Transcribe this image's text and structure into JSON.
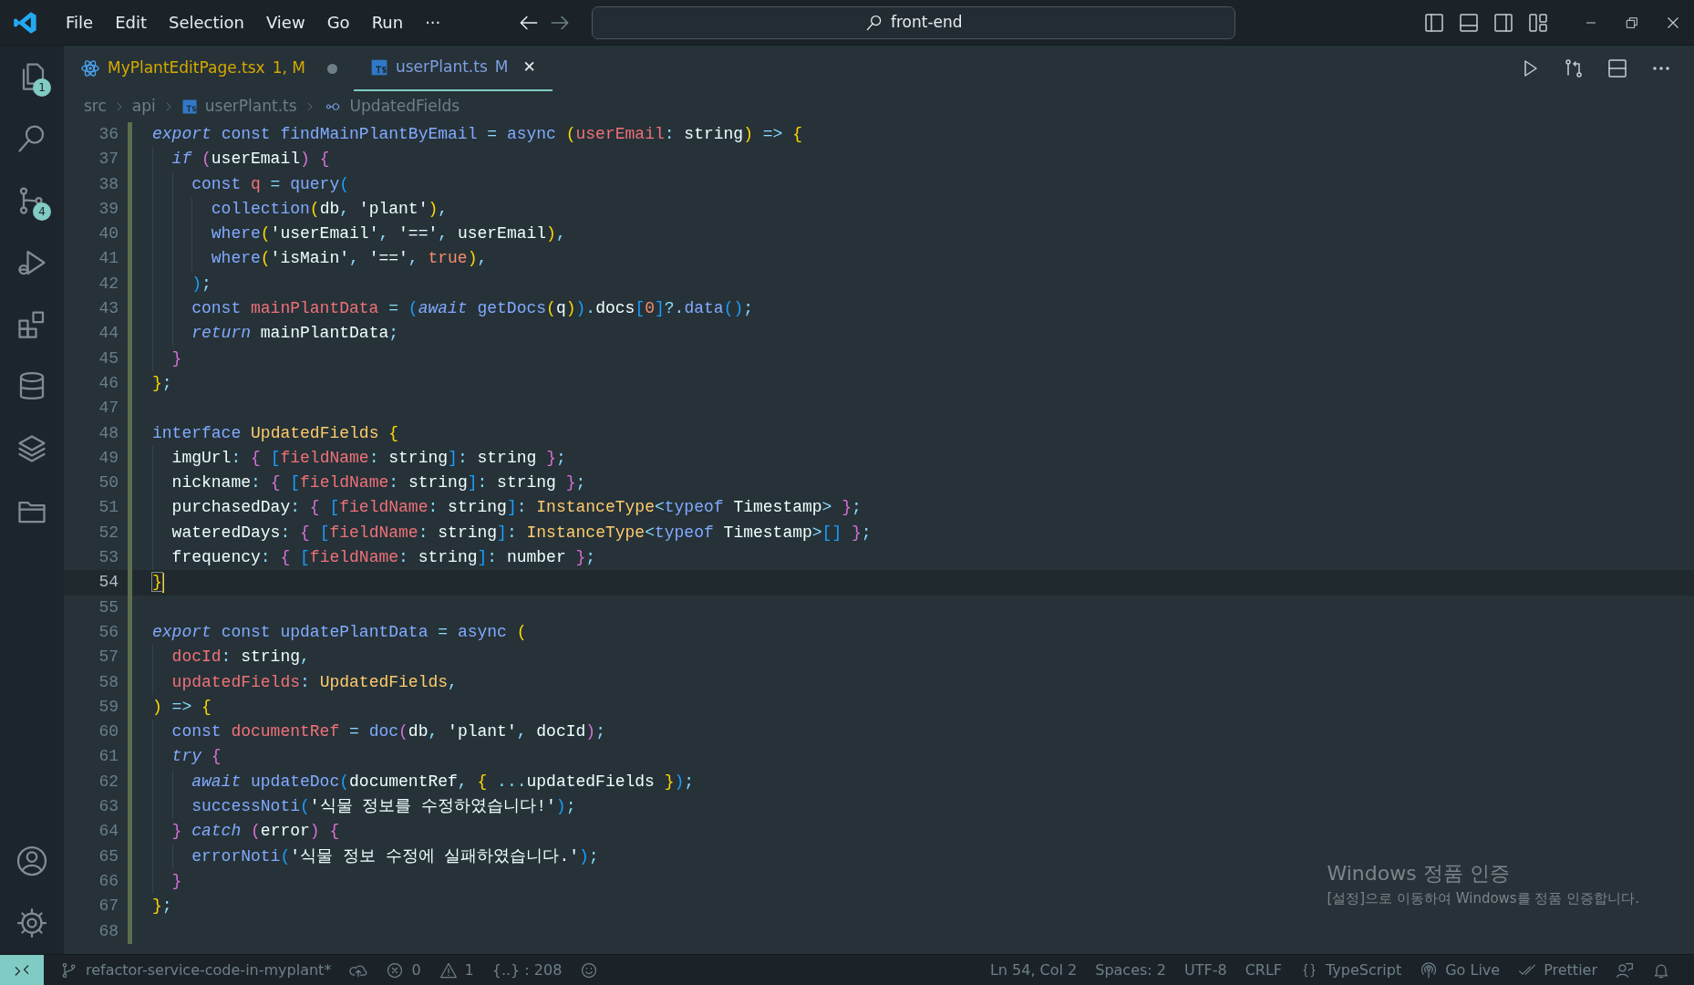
{
  "title_bar": {
    "menu": [
      "File",
      "Edit",
      "Selection",
      "View",
      "Go",
      "Run"
    ],
    "more": "···",
    "search": "front-end"
  },
  "activity_bar": {
    "items": [
      {
        "selected": false,
        "badge": "1"
      },
      {
        "selected": false
      },
      {
        "selected": false,
        "badge": "4"
      },
      {
        "selected": false
      },
      {
        "selected": false
      },
      {
        "selected": false
      },
      {
        "selected": false
      },
      {
        "selected": false
      }
    ],
    "bottom": [
      {
        "selected": false
      },
      {
        "selected": false
      }
    ]
  },
  "tabs": [
    {
      "label": "MyPlantEditPage.tsx",
      "status": "1, M",
      "kind": "react",
      "selected": false,
      "dirty": true
    },
    {
      "label": "userPlant.ts",
      "status": "M",
      "kind": "ts",
      "selected": true,
      "dirty": false,
      "close": "✕"
    }
  ],
  "breadcrumbs": [
    {
      "label": "src",
      "kind": "folder"
    },
    {
      "label": "api",
      "kind": "folder"
    },
    {
      "label": "userPlant.ts",
      "kind": "ts"
    },
    {
      "label": "UpdatedFields",
      "kind": "interface"
    }
  ],
  "editor": {
    "lines": [
      {
        "number": "36",
        "current": false,
        "modified": true,
        "tokens": [
          {
            "kw": "export "
          },
          {
            "st": "const "
          },
          {
            "fn": "findMainPlantByEmail"
          },
          {
            "op": " = "
          },
          {
            "st": "async "
          },
          {
            "b1": "("
          },
          {
            "var": "userEmail"
          },
          {
            "op": ": "
          },
          {
            "p": "string"
          },
          {
            "b1": ")"
          },
          {
            "op": " => "
          },
          {
            "b1": "{"
          }
        ]
      },
      {
        "number": "37",
        "current": false,
        "modified": true,
        "tokens": [
          {
            "kw": "  if "
          },
          {
            "b2": "("
          },
          {
            "p": "userEmail"
          },
          {
            "b2": ")"
          },
          {
            "b2": " {"
          }
        ]
      },
      {
        "number": "38",
        "current": false,
        "modified": true,
        "tokens": [
          {
            "st": "    const "
          },
          {
            "var": "q"
          },
          {
            "op": " = "
          },
          {
            "fn": "query"
          },
          {
            "b3": "("
          }
        ]
      },
      {
        "number": "39",
        "current": false,
        "modified": true,
        "tokens": [
          {
            "fn": "      collection"
          },
          {
            "b1": "("
          },
          {
            "p": "db"
          },
          {
            "op": ", "
          },
          {
            "str": "'plant'"
          },
          {
            "b1": ")"
          },
          {
            "op": ","
          }
        ]
      },
      {
        "number": "40",
        "current": false,
        "modified": true,
        "tokens": [
          {
            "fn": "      where"
          },
          {
            "b1": "("
          },
          {
            "str": "'userEmail'"
          },
          {
            "op": ", "
          },
          {
            "str": "'=='"
          },
          {
            "op": ", "
          },
          {
            "p": "userEmail"
          },
          {
            "b1": ")"
          },
          {
            "op": ","
          }
        ]
      },
      {
        "number": "41",
        "current": false,
        "modified": true,
        "tokens": [
          {
            "fn": "      where"
          },
          {
            "b1": "("
          },
          {
            "str": "'isMain'"
          },
          {
            "op": ", "
          },
          {
            "str": "'=='"
          },
          {
            "op": ", "
          },
          {
            "num": "true"
          },
          {
            "b1": ")"
          },
          {
            "op": ","
          }
        ]
      },
      {
        "number": "42",
        "current": false,
        "modified": true,
        "tokens": [
          {
            "b3": "    )"
          },
          {
            "op": ";"
          }
        ]
      },
      {
        "number": "43",
        "current": false,
        "modified": true,
        "tokens": [
          {
            "st": "    const "
          },
          {
            "var": "mainPlantData"
          },
          {
            "op": " = "
          },
          {
            "b3": "("
          },
          {
            "kw": "await "
          },
          {
            "fn": "getDocs"
          },
          {
            "b1": "("
          },
          {
            "p": "q"
          },
          {
            "b1": ")"
          },
          {
            "b3": ")"
          },
          {
            "op": "."
          },
          {
            "p": "docs"
          },
          {
            "b3": "["
          },
          {
            "num": "0"
          },
          {
            "b3": "]"
          },
          {
            "op": "?."
          },
          {
            "fn": "data"
          },
          {
            "b3": "()"
          },
          {
            "op": ";"
          }
        ]
      },
      {
        "number": "44",
        "current": false,
        "modified": true,
        "tokens": [
          {
            "kw": "    return "
          },
          {
            "p": "mainPlantData"
          },
          {
            "op": ";"
          }
        ]
      },
      {
        "number": "45",
        "current": false,
        "modified": true,
        "tokens": [
          {
            "b2": "  }"
          }
        ]
      },
      {
        "number": "46",
        "current": false,
        "modified": true,
        "tokens": [
          {
            "b1": "}"
          },
          {
            "op": ";"
          }
        ]
      },
      {
        "number": "47",
        "current": false,
        "modified": true
      },
      {
        "number": "48",
        "current": false,
        "modified": true,
        "tokens": [
          {
            "st": "interface "
          },
          {
            "ty": "UpdatedFields "
          },
          {
            "b1": "{"
          }
        ]
      },
      {
        "number": "49",
        "current": false,
        "modified": true,
        "tokens": [
          {
            "p": "  imgUrl"
          },
          {
            "op": ": "
          },
          {
            "b2": "{ "
          },
          {
            "b3": "["
          },
          {
            "var": "fieldName"
          },
          {
            "op": ": "
          },
          {
            "p": "string"
          },
          {
            "b3": "]"
          },
          {
            "op": ": "
          },
          {
            "p": "string "
          },
          {
            "b2": "}"
          },
          {
            "op": ";"
          }
        ]
      },
      {
        "number": "50",
        "current": false,
        "modified": true,
        "tokens": [
          {
            "p": "  nickname"
          },
          {
            "op": ": "
          },
          {
            "b2": "{ "
          },
          {
            "b3": "["
          },
          {
            "var": "fieldName"
          },
          {
            "op": ": "
          },
          {
            "p": "string"
          },
          {
            "b3": "]"
          },
          {
            "op": ": "
          },
          {
            "p": "string "
          },
          {
            "b2": "}"
          },
          {
            "op": ";"
          }
        ]
      },
      {
        "number": "51",
        "current": false,
        "modified": true,
        "tokens": [
          {
            "p": "  purchasedDay"
          },
          {
            "op": ": "
          },
          {
            "b2": "{ "
          },
          {
            "b3": "["
          },
          {
            "var": "fieldName"
          },
          {
            "op": ": "
          },
          {
            "p": "string"
          },
          {
            "b3": "]"
          },
          {
            "op": ": "
          },
          {
            "ty": "InstanceType"
          },
          {
            "op": "<"
          },
          {
            "st": "typeof "
          },
          {
            "p": "Timestamp"
          },
          {
            "op": "> "
          },
          {
            "b2": "}"
          },
          {
            "op": ";"
          }
        ]
      },
      {
        "number": "52",
        "current": false,
        "modified": true,
        "tokens": [
          {
            "p": "  wateredDays"
          },
          {
            "op": ": "
          },
          {
            "b2": "{ "
          },
          {
            "b3": "["
          },
          {
            "var": "fieldName"
          },
          {
            "op": ": "
          },
          {
            "p": "string"
          },
          {
            "b3": "]"
          },
          {
            "op": ": "
          },
          {
            "ty": "InstanceType"
          },
          {
            "op": "<"
          },
          {
            "st": "typeof "
          },
          {
            "p": "Timestamp"
          },
          {
            "op": ">"
          },
          {
            "b3": "[] "
          },
          {
            "b2": "}"
          },
          {
            "op": ";"
          }
        ]
      },
      {
        "number": "53",
        "current": false,
        "modified": true,
        "tokens": [
          {
            "p": "  frequency"
          },
          {
            "op": ": "
          },
          {
            "b2": "{ "
          },
          {
            "b3": "["
          },
          {
            "var": "fieldName"
          },
          {
            "op": ": "
          },
          {
            "p": "string"
          },
          {
            "b3": "]"
          },
          {
            "op": ": "
          },
          {
            "p": "number "
          },
          {
            "b2": "}"
          },
          {
            "op": ";"
          }
        ]
      },
      {
        "number": "54",
        "current": true,
        "modified": true,
        "tokens": [
          {
            "b1": "}"
          }
        ]
      },
      {
        "number": "55",
        "current": false,
        "modified": true
      },
      {
        "number": "56",
        "current": false,
        "modified": true,
        "tokens": [
          {
            "kw": "export "
          },
          {
            "st": "const "
          },
          {
            "fn": "updatePlantData"
          },
          {
            "op": " = "
          },
          {
            "st": "async "
          },
          {
            "b1": "("
          }
        ]
      },
      {
        "number": "57",
        "current": false,
        "modified": true,
        "tokens": [
          {
            "var": "  docId"
          },
          {
            "op": ": "
          },
          {
            "p": "string"
          },
          {
            "op": ","
          }
        ]
      },
      {
        "number": "58",
        "current": false,
        "modified": true,
        "tokens": [
          {
            "var": "  updatedFields"
          },
          {
            "op": ": "
          },
          {
            "ty": "UpdatedFields"
          },
          {
            "op": ","
          }
        ]
      },
      {
        "number": "59",
        "current": false,
        "modified": true,
        "tokens": [
          {
            "b1": ")"
          },
          {
            "op": " => "
          },
          {
            "b1": "{"
          }
        ]
      },
      {
        "number": "60",
        "current": false,
        "modified": true,
        "tokens": [
          {
            "st": "  const "
          },
          {
            "var": "documentRef"
          },
          {
            "op": " = "
          },
          {
            "fn": "doc"
          },
          {
            "b2": "("
          },
          {
            "p": "db"
          },
          {
            "op": ", "
          },
          {
            "str": "'plant'"
          },
          {
            "op": ", "
          },
          {
            "p": "docId"
          },
          {
            "b2": ")"
          },
          {
            "op": ";"
          }
        ]
      },
      {
        "number": "61",
        "current": false,
        "modified": true,
        "tokens": [
          {
            "kw": "  try "
          },
          {
            "b2": "{"
          }
        ]
      },
      {
        "number": "62",
        "current": false,
        "modified": true,
        "tokens": [
          {
            "kw": "    await "
          },
          {
            "fn": "updateDoc"
          },
          {
            "b3": "("
          },
          {
            "p": "documentRef"
          },
          {
            "op": ", "
          },
          {
            "b1": "{ "
          },
          {
            "op": "..."
          },
          {
            "p": "updatedFields "
          },
          {
            "b1": "}"
          },
          {
            "b3": ")"
          },
          {
            "op": ";"
          }
        ]
      },
      {
        "number": "63",
        "current": false,
        "modified": true,
        "tokens": [
          {
            "fn": "    successNoti"
          },
          {
            "b3": "("
          },
          {
            "str": "'식물 정보를 수정하였습니다!'"
          },
          {
            "b3": ")"
          },
          {
            "op": ";"
          }
        ]
      },
      {
        "number": "64",
        "current": false,
        "modified": true,
        "tokens": [
          {
            "b2": "  } "
          },
          {
            "kw": "catch "
          },
          {
            "b2": "("
          },
          {
            "p": "error"
          },
          {
            "b2": ") {"
          }
        ]
      },
      {
        "number": "65",
        "current": false,
        "modified": true,
        "tokens": [
          {
            "fn": "    errorNoti"
          },
          {
            "b3": "("
          },
          {
            "str": "'식물 정보 수정에 실패하였습니다.'"
          },
          {
            "b3": ")"
          },
          {
            "op": ";"
          }
        ]
      },
      {
        "number": "66",
        "current": false,
        "modified": true,
        "tokens": [
          {
            "b2": "  }"
          }
        ]
      },
      {
        "number": "67",
        "current": false,
        "modified": true,
        "tokens": [
          {
            "b1": "}"
          },
          {
            "op": ";"
          }
        ]
      },
      {
        "number": "68",
        "current": false,
        "modified": true
      }
    ]
  },
  "activation_notice": {
    "title": "Windows 정품 인증",
    "message": "[설정]으로 이동하여 Windows를 정품 인증합니다."
  },
  "status_bar": {
    "left": [
      {
        "kind": "branch",
        "text": "refactor-service-code-in-myplant*"
      },
      {
        "kind": "sync"
      },
      {
        "kind": "errors",
        "text": "0"
      },
      {
        "kind": "warnings",
        "text": "1"
      },
      {
        "kind": "plain",
        "text": "{..} : 208"
      },
      {
        "kind": "smiley"
      }
    ],
    "right": [
      {
        "kind": "plain",
        "text": "Ln 54, Col 2"
      },
      {
        "kind": "plain",
        "text": "Spaces: 2"
      },
      {
        "kind": "plain",
        "text": "UTF-8"
      },
      {
        "kind": "plain",
        "text": "CRLF"
      },
      {
        "kind": "braces",
        "text": "TypeScript"
      },
      {
        "kind": "live",
        "text": "Go Live"
      },
      {
        "kind": "check",
        "text": "Prettier"
      },
      {
        "kind": "feedback"
      },
      {
        "kind": "bell"
      }
    ]
  }
}
